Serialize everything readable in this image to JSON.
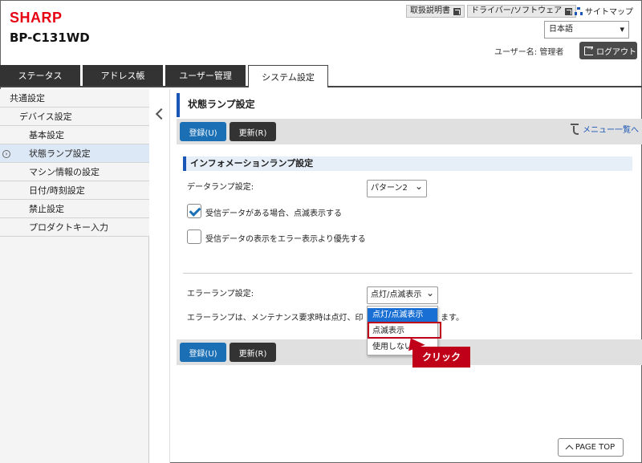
{
  "header": {
    "brand": "SHARP",
    "model": "BP-C131WD",
    "manual_label": "取扱説明書",
    "driver_label": "ドライバー/ソフトウェア",
    "sitemap_label": "サイトマップ",
    "language_value": "日本語",
    "user_label": "ユーザー名: 管理者",
    "logout_label": "ログアウト"
  },
  "tabs": [
    {
      "label": "ステータス",
      "active": false
    },
    {
      "label": "アドレス帳",
      "active": false
    },
    {
      "label": "ユーザー管理",
      "active": false
    },
    {
      "label": "システム設定",
      "active": true
    }
  ],
  "sidebar": {
    "items": [
      {
        "label": "共通設定",
        "level": 0,
        "active": false
      },
      {
        "label": "デバイス設定",
        "level": 1,
        "active": false
      },
      {
        "label": "基本設定",
        "level": 2,
        "active": false
      },
      {
        "label": "状態ランプ設定",
        "level": 2,
        "active": true
      },
      {
        "label": "マシン情報の設定",
        "level": 2,
        "active": false
      },
      {
        "label": "日付/時刻設定",
        "level": 2,
        "active": false
      },
      {
        "label": "禁止設定",
        "level": 2,
        "active": false
      },
      {
        "label": "プロダクトキー入力",
        "level": 2,
        "active": false
      }
    ]
  },
  "main": {
    "title": "状態ランプ設定",
    "register_label": "登録(U)",
    "update_label": "更新(R)",
    "menu_link": "メニュー一覧へ",
    "section_title": "インフォメーションランプ設定",
    "data_lamp_label": "データランプ設定:",
    "data_lamp_value": "パターン2",
    "cb1_label": "受信データがある場合、点滅表示する",
    "cb2_label": "受信データの表示をエラー表示より優先する",
    "error_lamp_label": "エラーランプ設定:",
    "error_lamp_value": "点灯/点滅表示",
    "error_desc_left": "エラーランプは、メンテナンス要求時は点灯、印",
    "error_desc_right": "ます。",
    "dropdown_options": [
      "点灯/点滅表示",
      "点滅表示",
      "使用しない"
    ],
    "callout": "クリック",
    "page_top": "PAGE TOP"
  }
}
